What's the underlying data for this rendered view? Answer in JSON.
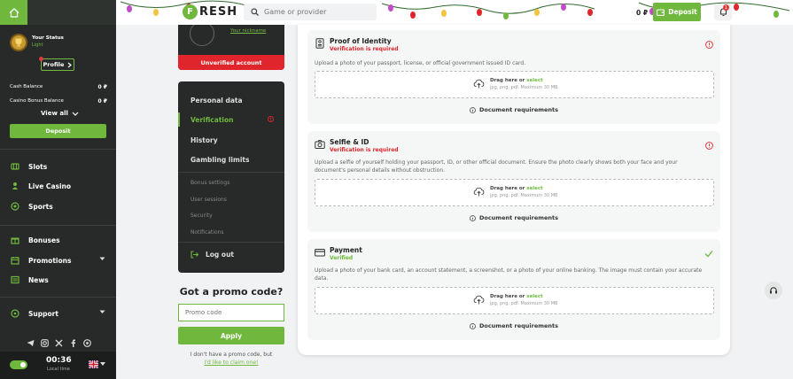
{
  "sidebar": {
    "status_title": "Your Status",
    "status_level": "Light",
    "profile_label": "Profile",
    "cash_balance_label": "Cash Balance",
    "cash_balance_value": "0 ₽",
    "bonus_balance_label": "Casino Bonus Balance",
    "bonus_balance_value": "0 ₽",
    "view_all_label": "View all",
    "deposit_label": "Deposit",
    "nav": [
      {
        "label": "Slots",
        "icon": "slots-icon"
      },
      {
        "label": "Live Casino",
        "icon": "live-casino-icon"
      },
      {
        "label": "Sports",
        "icon": "sports-icon"
      },
      {
        "label": "Bonuses",
        "icon": "gift-icon"
      },
      {
        "label": "Promotions",
        "icon": "calendar-icon",
        "dropdown": true
      },
      {
        "label": "News",
        "icon": "news-icon"
      },
      {
        "label": "Support",
        "icon": "support-icon",
        "dropdown": true
      }
    ],
    "socials": [
      "telegram-icon",
      "instagram-icon",
      "x-icon",
      "facebook-icon",
      "whatsapp-icon"
    ],
    "time": "00:36",
    "time_label": "Local time",
    "language_flag": "uk-flag-icon"
  },
  "header": {
    "logo_letter": "F",
    "logo_text": "RESH",
    "search_placeholder": "Game or provider",
    "balance": "0 ₽",
    "deposit_label": "Deposit",
    "notifications_count": "1"
  },
  "account": {
    "nickname_label": "Your nickname",
    "unverified_label": "Unverified account",
    "menu_main": [
      "Personal data",
      "Verification",
      "History",
      "Gambling limits"
    ],
    "active_item": "Verification",
    "menu_sub": [
      "Bonus settings",
      "User sessions",
      "Security",
      "Notifications"
    ],
    "logout_label": "Log out"
  },
  "promo": {
    "title": "Got a promo code?",
    "placeholder": "Promo code",
    "apply_label": "Apply",
    "note": "I don't have a promo code, but",
    "link": "I'd like to claim one!"
  },
  "documents": [
    {
      "title": "Proof of Identity",
      "status": "Verification is required",
      "state": "required",
      "icon": "id-card-icon",
      "description": "Upload a photo of your passport, license, or official government issued ID card.",
      "drop_text": "Drag here or",
      "drop_link": "select",
      "drop_formats": "jpg, png, pdf. Maximum 30 MB",
      "requirements_label": "Document requirements"
    },
    {
      "title": "Selfie & ID",
      "status": "Verification is required",
      "state": "required",
      "icon": "camera-icon",
      "description": "Upload a selfie of yourself holding your passport, ID, or other official document. Ensure the photo clearly shows both your face and your document's personal details without obstruction.",
      "drop_text": "Drag here or",
      "drop_link": "select",
      "drop_formats": "jpg, png, pdf. Maximum 30 MB",
      "requirements_label": "Document requirements"
    },
    {
      "title": "Payment",
      "status": "Verified",
      "state": "verified",
      "icon": "card-icon",
      "description": "Upload a photo of your bank card, an account statement, a screenshot, or a photo of your online banking. The image must contain your accurate data.",
      "drop_text": "Drag here or",
      "drop_link": "select",
      "drop_formats": "jpg, png, pdf. Maximum 30 MB",
      "requirements_label": "Document requirements"
    }
  ],
  "colors": {
    "brand_green": "#6fb83d",
    "alert_red": "#e0262c",
    "sidebar_bg": "#272a28"
  }
}
